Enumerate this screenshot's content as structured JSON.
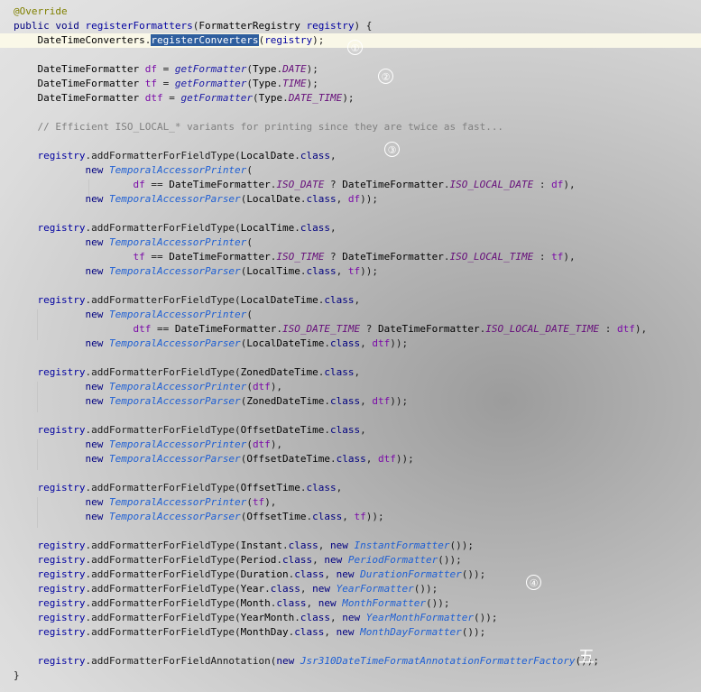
{
  "editor": {
    "lines": [
      [
        [
          "ann",
          "@Override"
        ]
      ],
      [
        [
          "kw",
          "public "
        ],
        [
          "kw",
          "void "
        ],
        [
          "id",
          "registerFormatters"
        ],
        [
          "pl",
          "("
        ],
        [
          "typ",
          "FormatterRegistry "
        ],
        [
          "id",
          "registry"
        ],
        [
          "pl",
          ") {"
        ]
      ],
      [
        [
          "pl",
          "    "
        ],
        [
          "typ",
          "DateTimeConverters"
        ],
        [
          "pl",
          "."
        ],
        [
          "sel",
          "registerConverters"
        ],
        [
          "pl",
          "("
        ],
        [
          "id",
          "registry"
        ],
        [
          "pl",
          ");"
        ]
      ],
      [],
      [
        [
          "pl",
          "    "
        ],
        [
          "typ",
          "DateTimeFormatter "
        ],
        [
          "fld",
          "df"
        ],
        [
          "pl",
          " = "
        ],
        [
          "sfn",
          "getFormatter"
        ],
        [
          "pl",
          "("
        ],
        [
          "typ",
          "Type"
        ],
        [
          "pl",
          "."
        ],
        [
          "ifld",
          "DATE"
        ],
        [
          "pl",
          ");"
        ]
      ],
      [
        [
          "pl",
          "    "
        ],
        [
          "typ",
          "DateTimeFormatter "
        ],
        [
          "fld",
          "tf"
        ],
        [
          "pl",
          " = "
        ],
        [
          "sfn",
          "getFormatter"
        ],
        [
          "pl",
          "("
        ],
        [
          "typ",
          "Type"
        ],
        [
          "pl",
          "."
        ],
        [
          "ifld",
          "TIME"
        ],
        [
          "pl",
          ");"
        ]
      ],
      [
        [
          "pl",
          "    "
        ],
        [
          "typ",
          "DateTimeFormatter "
        ],
        [
          "fld",
          "dtf"
        ],
        [
          "pl",
          " = "
        ],
        [
          "sfn",
          "getFormatter"
        ],
        [
          "pl",
          "("
        ],
        [
          "typ",
          "Type"
        ],
        [
          "pl",
          "."
        ],
        [
          "ifld",
          "DATE_TIME"
        ],
        [
          "pl",
          ");"
        ]
      ],
      [],
      [
        [
          "pl",
          "    "
        ],
        [
          "cmt",
          "// Efficient ISO_LOCAL_* variants for printing since they are twice as fast..."
        ]
      ],
      [],
      [
        [
          "pl",
          "    "
        ],
        [
          "id",
          "registry"
        ],
        [
          "pl",
          ".addFormatterForFieldType("
        ],
        [
          "typ",
          "LocalDate"
        ],
        [
          "pl",
          "."
        ],
        [
          "kw",
          "class"
        ],
        [
          "pl",
          ","
        ]
      ],
      [
        [
          "pl",
          "            "
        ],
        [
          "kw",
          "new "
        ],
        [
          "cls",
          "TemporalAccessorPrinter"
        ],
        [
          "pl",
          "("
        ]
      ],
      [
        [
          "pl",
          "                    "
        ],
        [
          "fld",
          "df"
        ],
        [
          "pl",
          " == "
        ],
        [
          "typ",
          "DateTimeFormatter"
        ],
        [
          "pl",
          "."
        ],
        [
          "ifld",
          "ISO_DATE"
        ],
        [
          "pl",
          " ? "
        ],
        [
          "typ",
          "DateTimeFormatter"
        ],
        [
          "pl",
          "."
        ],
        [
          "ifld",
          "ISO_LOCAL_DATE"
        ],
        [
          "pl",
          " : "
        ],
        [
          "fld",
          "df"
        ],
        [
          "pl",
          "),"
        ]
      ],
      [
        [
          "pl",
          "            "
        ],
        [
          "kw",
          "new "
        ],
        [
          "cls",
          "TemporalAccessorParser"
        ],
        [
          "pl",
          "("
        ],
        [
          "typ",
          "LocalDate"
        ],
        [
          "pl",
          "."
        ],
        [
          "kw",
          "class"
        ],
        [
          "pl",
          ", "
        ],
        [
          "fld",
          "df"
        ],
        [
          "pl",
          "));"
        ]
      ],
      [],
      [
        [
          "pl",
          "    "
        ],
        [
          "id",
          "registry"
        ],
        [
          "pl",
          ".addFormatterForFieldType("
        ],
        [
          "typ",
          "LocalTime"
        ],
        [
          "pl",
          "."
        ],
        [
          "kw",
          "class"
        ],
        [
          "pl",
          ","
        ]
      ],
      [
        [
          "pl",
          "            "
        ],
        [
          "kw",
          "new "
        ],
        [
          "cls",
          "TemporalAccessorPrinter"
        ],
        [
          "pl",
          "("
        ]
      ],
      [
        [
          "pl",
          "                    "
        ],
        [
          "fld",
          "tf"
        ],
        [
          "pl",
          " == "
        ],
        [
          "typ",
          "DateTimeFormatter"
        ],
        [
          "pl",
          "."
        ],
        [
          "ifld",
          "ISO_TIME"
        ],
        [
          "pl",
          " ? "
        ],
        [
          "typ",
          "DateTimeFormatter"
        ],
        [
          "pl",
          "."
        ],
        [
          "ifld",
          "ISO_LOCAL_TIME"
        ],
        [
          "pl",
          " : "
        ],
        [
          "fld",
          "tf"
        ],
        [
          "pl",
          "),"
        ]
      ],
      [
        [
          "pl",
          "            "
        ],
        [
          "kw",
          "new "
        ],
        [
          "cls",
          "TemporalAccessorParser"
        ],
        [
          "pl",
          "("
        ],
        [
          "typ",
          "LocalTime"
        ],
        [
          "pl",
          "."
        ],
        [
          "kw",
          "class"
        ],
        [
          "pl",
          ", "
        ],
        [
          "fld",
          "tf"
        ],
        [
          "pl",
          "));"
        ]
      ],
      [],
      [
        [
          "pl",
          "    "
        ],
        [
          "id",
          "registry"
        ],
        [
          "pl",
          ".addFormatterForFieldType("
        ],
        [
          "typ",
          "LocalDateTime"
        ],
        [
          "pl",
          "."
        ],
        [
          "kw",
          "class"
        ],
        [
          "pl",
          ","
        ]
      ],
      [
        [
          "pl",
          "            "
        ],
        [
          "kw",
          "new "
        ],
        [
          "cls",
          "TemporalAccessorPrinter"
        ],
        [
          "pl",
          "("
        ]
      ],
      [
        [
          "pl",
          "                    "
        ],
        [
          "fld",
          "dtf"
        ],
        [
          "pl",
          " == "
        ],
        [
          "typ",
          "DateTimeFormatter"
        ],
        [
          "pl",
          "."
        ],
        [
          "ifld",
          "ISO_DATE_TIME"
        ],
        [
          "pl",
          " ? "
        ],
        [
          "typ",
          "DateTimeFormatter"
        ],
        [
          "pl",
          "."
        ],
        [
          "ifld",
          "ISO_LOCAL_DATE_TIME"
        ],
        [
          "pl",
          " : "
        ],
        [
          "fld",
          "dtf"
        ],
        [
          "pl",
          "),"
        ]
      ],
      [
        [
          "pl",
          "            "
        ],
        [
          "kw",
          "new "
        ],
        [
          "cls",
          "TemporalAccessorParser"
        ],
        [
          "pl",
          "("
        ],
        [
          "typ",
          "LocalDateTime"
        ],
        [
          "pl",
          "."
        ],
        [
          "kw",
          "class"
        ],
        [
          "pl",
          ", "
        ],
        [
          "fld",
          "dtf"
        ],
        [
          "pl",
          "));"
        ]
      ],
      [],
      [
        [
          "pl",
          "    "
        ],
        [
          "id",
          "registry"
        ],
        [
          "pl",
          ".addFormatterForFieldType("
        ],
        [
          "typ",
          "ZonedDateTime"
        ],
        [
          "pl",
          "."
        ],
        [
          "kw",
          "class"
        ],
        [
          "pl",
          ","
        ]
      ],
      [
        [
          "pl",
          "            "
        ],
        [
          "kw",
          "new "
        ],
        [
          "cls",
          "TemporalAccessorPrinter"
        ],
        [
          "pl",
          "("
        ],
        [
          "fld",
          "dtf"
        ],
        [
          "pl",
          "),"
        ]
      ],
      [
        [
          "pl",
          "            "
        ],
        [
          "kw",
          "new "
        ],
        [
          "cls",
          "TemporalAccessorParser"
        ],
        [
          "pl",
          "("
        ],
        [
          "typ",
          "ZonedDateTime"
        ],
        [
          "pl",
          "."
        ],
        [
          "kw",
          "class"
        ],
        [
          "pl",
          ", "
        ],
        [
          "fld",
          "dtf"
        ],
        [
          "pl",
          "));"
        ]
      ],
      [],
      [
        [
          "pl",
          "    "
        ],
        [
          "id",
          "registry"
        ],
        [
          "pl",
          ".addFormatterForFieldType("
        ],
        [
          "typ",
          "OffsetDateTime"
        ],
        [
          "pl",
          "."
        ],
        [
          "kw",
          "class"
        ],
        [
          "pl",
          ","
        ]
      ],
      [
        [
          "pl",
          "            "
        ],
        [
          "kw",
          "new "
        ],
        [
          "cls",
          "TemporalAccessorPrinter"
        ],
        [
          "pl",
          "("
        ],
        [
          "fld",
          "dtf"
        ],
        [
          "pl",
          "),"
        ]
      ],
      [
        [
          "pl",
          "            "
        ],
        [
          "kw",
          "new "
        ],
        [
          "cls",
          "TemporalAccessorParser"
        ],
        [
          "pl",
          "("
        ],
        [
          "typ",
          "OffsetDateTime"
        ],
        [
          "pl",
          "."
        ],
        [
          "kw",
          "class"
        ],
        [
          "pl",
          ", "
        ],
        [
          "fld",
          "dtf"
        ],
        [
          "pl",
          "));"
        ]
      ],
      [],
      [
        [
          "pl",
          "    "
        ],
        [
          "id",
          "registry"
        ],
        [
          "pl",
          ".addFormatterForFieldType("
        ],
        [
          "typ",
          "OffsetTime"
        ],
        [
          "pl",
          "."
        ],
        [
          "kw",
          "class"
        ],
        [
          "pl",
          ","
        ]
      ],
      [
        [
          "pl",
          "            "
        ],
        [
          "kw",
          "new "
        ],
        [
          "cls",
          "TemporalAccessorPrinter"
        ],
        [
          "pl",
          "("
        ],
        [
          "fld",
          "tf"
        ],
        [
          "pl",
          "),"
        ]
      ],
      [
        [
          "pl",
          "            "
        ],
        [
          "kw",
          "new "
        ],
        [
          "cls",
          "TemporalAccessorParser"
        ],
        [
          "pl",
          "("
        ],
        [
          "typ",
          "OffsetTime"
        ],
        [
          "pl",
          "."
        ],
        [
          "kw",
          "class"
        ],
        [
          "pl",
          ", "
        ],
        [
          "fld",
          "tf"
        ],
        [
          "pl",
          "));"
        ]
      ],
      [],
      [
        [
          "pl",
          "    "
        ],
        [
          "id",
          "registry"
        ],
        [
          "pl",
          ".addFormatterForFieldType("
        ],
        [
          "typ",
          "Instant"
        ],
        [
          "pl",
          "."
        ],
        [
          "kw",
          "class"
        ],
        [
          "pl",
          ", "
        ],
        [
          "kw",
          "new "
        ],
        [
          "cls",
          "InstantFormatter"
        ],
        [
          "pl",
          "());"
        ]
      ],
      [
        [
          "pl",
          "    "
        ],
        [
          "id",
          "registry"
        ],
        [
          "pl",
          ".addFormatterForFieldType("
        ],
        [
          "typ",
          "Period"
        ],
        [
          "pl",
          "."
        ],
        [
          "kw",
          "class"
        ],
        [
          "pl",
          ", "
        ],
        [
          "kw",
          "new "
        ],
        [
          "cls",
          "PeriodFormatter"
        ],
        [
          "pl",
          "());"
        ]
      ],
      [
        [
          "pl",
          "    "
        ],
        [
          "id",
          "registry"
        ],
        [
          "pl",
          ".addFormatterForFieldType("
        ],
        [
          "typ",
          "Duration"
        ],
        [
          "pl",
          "."
        ],
        [
          "kw",
          "class"
        ],
        [
          "pl",
          ", "
        ],
        [
          "kw",
          "new "
        ],
        [
          "cls",
          "DurationFormatter"
        ],
        [
          "pl",
          "());"
        ]
      ],
      [
        [
          "pl",
          "    "
        ],
        [
          "id",
          "registry"
        ],
        [
          "pl",
          ".addFormatterForFieldType("
        ],
        [
          "typ",
          "Year"
        ],
        [
          "pl",
          "."
        ],
        [
          "kw",
          "class"
        ],
        [
          "pl",
          ", "
        ],
        [
          "kw",
          "new "
        ],
        [
          "cls",
          "YearFormatter"
        ],
        [
          "pl",
          "());"
        ]
      ],
      [
        [
          "pl",
          "    "
        ],
        [
          "id",
          "registry"
        ],
        [
          "pl",
          ".addFormatterForFieldType("
        ],
        [
          "typ",
          "Month"
        ],
        [
          "pl",
          "."
        ],
        [
          "kw",
          "class"
        ],
        [
          "pl",
          ", "
        ],
        [
          "kw",
          "new "
        ],
        [
          "cls",
          "MonthFormatter"
        ],
        [
          "pl",
          "());"
        ]
      ],
      [
        [
          "pl",
          "    "
        ],
        [
          "id",
          "registry"
        ],
        [
          "pl",
          ".addFormatterForFieldType("
        ],
        [
          "typ",
          "YearMonth"
        ],
        [
          "pl",
          "."
        ],
        [
          "kw",
          "class"
        ],
        [
          "pl",
          ", "
        ],
        [
          "kw",
          "new "
        ],
        [
          "cls",
          "YearMonthFormatter"
        ],
        [
          "pl",
          "());"
        ]
      ],
      [
        [
          "pl",
          "    "
        ],
        [
          "id",
          "registry"
        ],
        [
          "pl",
          ".addFormatterForFieldType("
        ],
        [
          "typ",
          "MonthDay"
        ],
        [
          "pl",
          "."
        ],
        [
          "kw",
          "class"
        ],
        [
          "pl",
          ", "
        ],
        [
          "kw",
          "new "
        ],
        [
          "cls",
          "MonthDayFormatter"
        ],
        [
          "pl",
          "());"
        ]
      ],
      [],
      [
        [
          "pl",
          "    "
        ],
        [
          "id",
          "registry"
        ],
        [
          "pl",
          ".addFormatterForFieldAnnotation("
        ],
        [
          "kw",
          "new "
        ],
        [
          "cls",
          "Jsr310DateTimeFormatAnnotationFormatterFactory"
        ],
        [
          "pl",
          "());"
        ]
      ],
      [
        [
          "pl",
          "}"
        ]
      ]
    ],
    "current_line": 2
  },
  "annotations": {
    "b1": "①",
    "b2": "②",
    "b3": "③",
    "b4": "④",
    "cjk": "五"
  }
}
